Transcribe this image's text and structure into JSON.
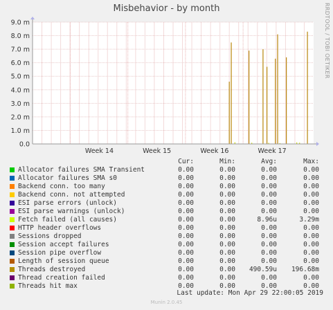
{
  "chart_data": {
    "type": "line",
    "title": "Misbehavior - by month",
    "side_label": "RRDTOOL / TOBI OETIKER",
    "ylim": [
      0,
      9000000
    ],
    "yticks": [
      {
        "value": 0,
        "label": "0.0"
      },
      {
        "value": 1000000,
        "label": "1.0 m"
      },
      {
        "value": 2000000,
        "label": "2.0 m"
      },
      {
        "value": 3000000,
        "label": "3.0 m"
      },
      {
        "value": 4000000,
        "label": "4.0 m"
      },
      {
        "value": 5000000,
        "label": "5.0 m"
      },
      {
        "value": 6000000,
        "label": "6.0 m"
      },
      {
        "value": 7000000,
        "label": "7.0 m"
      },
      {
        "value": 8000000,
        "label": "8.0 m"
      },
      {
        "value": 9000000,
        "label": "9.0 m"
      }
    ],
    "xlim": [
      0,
      1
    ],
    "xticks": [
      {
        "value": 0.24,
        "label": "Week 14"
      },
      {
        "value": 0.445,
        "label": "Week 15"
      },
      {
        "value": 0.65,
        "label": "Week 16"
      },
      {
        "value": 0.855,
        "label": "Week 17"
      }
    ],
    "grid": true,
    "series": [
      {
        "name": "Threads destroyed",
        "color": "#b8860b",
        "spikes": [
          {
            "x": 0.7,
            "y": 4600000
          },
          {
            "x": 0.707,
            "y": 7500000
          },
          {
            "x": 0.77,
            "y": 6900000
          },
          {
            "x": 0.82,
            "y": 7000000
          },
          {
            "x": 0.834,
            "y": 5700000
          },
          {
            "x": 0.864,
            "y": 6300000
          },
          {
            "x": 0.872,
            "y": 8100000
          },
          {
            "x": 0.903,
            "y": 6400000
          },
          {
            "x": 0.978,
            "y": 8300000
          }
        ]
      },
      {
        "name": "Fetch failed (all causes)",
        "color": "#ccdd00",
        "spikes": [
          {
            "x": 0.72,
            "y": 120000
          },
          {
            "x": 0.78,
            "y": 90000
          },
          {
            "x": 0.84,
            "y": 80000
          },
          {
            "x": 0.88,
            "y": 60000
          },
          {
            "x": 0.94,
            "y": 110000
          },
          {
            "x": 0.95,
            "y": 90000
          }
        ]
      }
    ]
  },
  "legend": {
    "headers": {
      "cur": "Cur:",
      "min": "Min:",
      "avg": "Avg:",
      "max": "Max:"
    },
    "rows": [
      {
        "name": "Allocator failures SMA Transient",
        "color": "#00cc00",
        "cur": "0.00",
        "min": "0.00",
        "avg": "0.00",
        "max": "0.00"
      },
      {
        "name": "Allocator failures SMA s0",
        "color": "#0066b3",
        "cur": "0.00",
        "min": "0.00",
        "avg": "0.00",
        "max": "0.00"
      },
      {
        "name": "Backend conn. too many",
        "color": "#ff8000",
        "cur": "0.00",
        "min": "0.00",
        "avg": "0.00",
        "max": "0.00"
      },
      {
        "name": "Backend conn. not attempted",
        "color": "#ffcc00",
        "cur": "0.00",
        "min": "0.00",
        "avg": "0.00",
        "max": "0.00"
      },
      {
        "name": "ESI parse errors (unlock)",
        "color": "#330099",
        "cur": "0.00",
        "min": "0.00",
        "avg": "0.00",
        "max": "0.00"
      },
      {
        "name": "ESI parse warnings (unlock)",
        "color": "#990099",
        "cur": "0.00",
        "min": "0.00",
        "avg": "0.00",
        "max": "0.00"
      },
      {
        "name": "Fetch failed (all causes)",
        "color": "#ccff00",
        "cur": "0.00",
        "min": "0.00",
        "avg": "8.96u",
        "max": "3.29m"
      },
      {
        "name": "HTTP header overflows",
        "color": "#ff0000",
        "cur": "0.00",
        "min": "0.00",
        "avg": "0.00",
        "max": "0.00"
      },
      {
        "name": "Sessions dropped",
        "color": "#808080",
        "cur": "0.00",
        "min": "0.00",
        "avg": "0.00",
        "max": "0.00"
      },
      {
        "name": "Session accept failures",
        "color": "#008f00",
        "cur": "0.00",
        "min": "0.00",
        "avg": "0.00",
        "max": "0.00"
      },
      {
        "name": "Session pipe overflow",
        "color": "#00487d",
        "cur": "0.00",
        "min": "0.00",
        "avg": "0.00",
        "max": "0.00"
      },
      {
        "name": "Length of session queue",
        "color": "#b35a00",
        "cur": "0.00",
        "min": "0.00",
        "avg": "0.00",
        "max": "0.00"
      },
      {
        "name": "Threads destroyed",
        "color": "#b38f00",
        "cur": "0.00",
        "min": "0.00",
        "avg": "490.59u",
        "max": "196.68m"
      },
      {
        "name": "Thread creation failed",
        "color": "#6b006b",
        "cur": "0.00",
        "min": "0.00",
        "avg": "0.00",
        "max": "0.00"
      },
      {
        "name": "Threads hit max",
        "color": "#8fb300",
        "cur": "0.00",
        "min": "0.00",
        "avg": "0.00",
        "max": "0.00"
      }
    ]
  },
  "last_update": "Last update: Mon Apr 29 22:00:05 2019",
  "footer": "Munin 2.0.45"
}
